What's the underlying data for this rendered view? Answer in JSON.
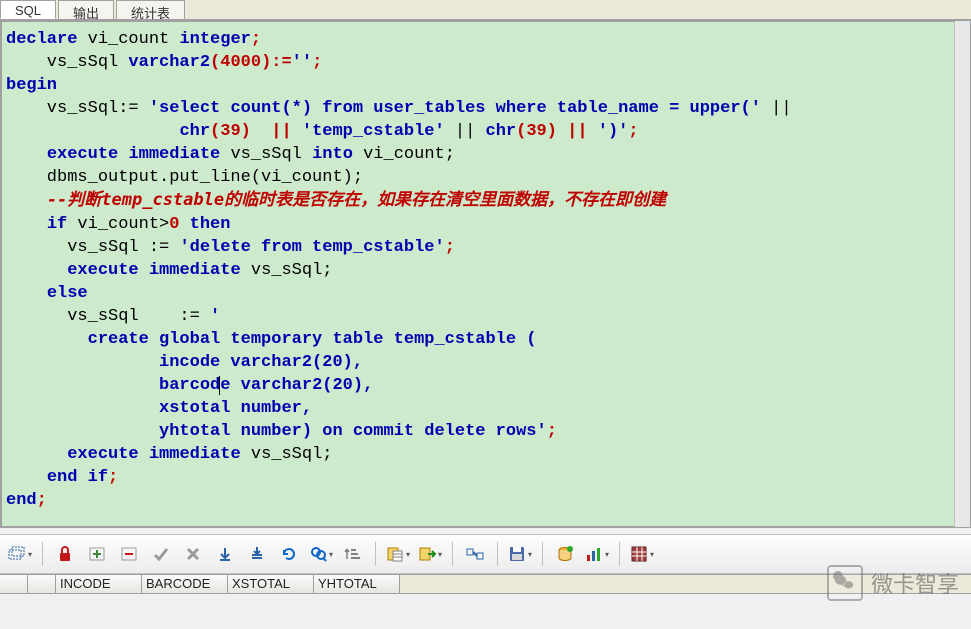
{
  "tabs": {
    "sql": "SQL",
    "output": "输出",
    "stats": "统计表",
    "active": "sql"
  },
  "code": {
    "l1": {
      "a": "declare",
      "b": " vi_count ",
      "c": "integer",
      "d": ";"
    },
    "l2": {
      "a": "    vs_sSql ",
      "b": "varchar2",
      "c": "(",
      "d": "4000",
      "e": "):=",
      "f": "''",
      "g": ";"
    },
    "l3": {
      "a": "begin"
    },
    "l4": {
      "a": "    vs_sSql:= ",
      "b": "'select count(*) from user_tables where table_name = upper('",
      "c": " || "
    },
    "l5": {
      "a": "                 ",
      "b": "chr",
      "c": "(",
      "d": "39",
      "e": ")  || ",
      "f": "'temp_cstable'",
      "g": " || ",
      "h": "chr",
      "i": "(",
      "j": "39",
      "k": ") || ",
      "l": "')'",
      "m": ";"
    },
    "l6": {
      "a": "    ",
      "b": "execute",
      "c": " ",
      "d": "immediate",
      "e": " vs_sSql ",
      "f": "into",
      "g": " vi_count;"
    },
    "l7": {
      "a": "    dbms_output.put_line(vi_count);"
    },
    "l8": {
      "a": "    ",
      "b": "--判断temp_cstable的临时表是否存在，如果存在清空里面数据，不存在即创建"
    },
    "l9": {
      "a": "    ",
      "b": "if",
      "c": " vi_count>",
      "d": "0",
      "e": " ",
      "f": "then"
    },
    "l10": {
      "a": "      vs_sSql := ",
      "b": "'delete from temp_cstable'",
      "c": ";"
    },
    "l11": {
      "a": "      ",
      "b": "execute",
      "c": " ",
      "d": "immediate",
      "e": " vs_sSql;"
    },
    "l12": {
      "a": "    ",
      "b": "else"
    },
    "l13": {
      "a": "      vs_sSql    := ",
      "b": "'"
    },
    "l14": {
      "a": "        create global temporary table temp_cstable ("
    },
    "l15": {
      "a": "               incode varchar2(20),"
    },
    "l16": {
      "a": "               barcod",
      "b": "e varchar2(20),"
    },
    "l17": {
      "a": "               xstotal number,"
    },
    "l18": {
      "a": "               yhtotal number) on commit delete rows'",
      "b": ";"
    },
    "l19": {
      "a": "      ",
      "b": "execute",
      "c": " ",
      "d": "immediate",
      "e": " vs_sSql;"
    },
    "l20": {
      "a": "    ",
      "b": "end",
      "c": " ",
      "d": "if",
      "e": ";"
    },
    "l21": {
      "a": "end",
      "b": ";"
    }
  },
  "toolbar": {
    "select_query": "Select query",
    "lock": "Lock",
    "add": "Add record",
    "delete": "Delete record",
    "commit": "Commit",
    "rollback": "Rollback",
    "fetch": "Fetch next",
    "fetch_all": "Fetch all",
    "refresh": "Refresh",
    "find": "Find",
    "sort": "Sort",
    "copy_cells": "Copy cells",
    "export": "Export",
    "link": "Link",
    "save": "Save",
    "db": "Session",
    "chart": "Chart",
    "grid": "Grid view"
  },
  "grid": {
    "columns": [
      "INCODE",
      "BARCODE",
      "XSTOTAL",
      "YHTOTAL"
    ]
  },
  "watermark": {
    "text": "微卡智享"
  }
}
